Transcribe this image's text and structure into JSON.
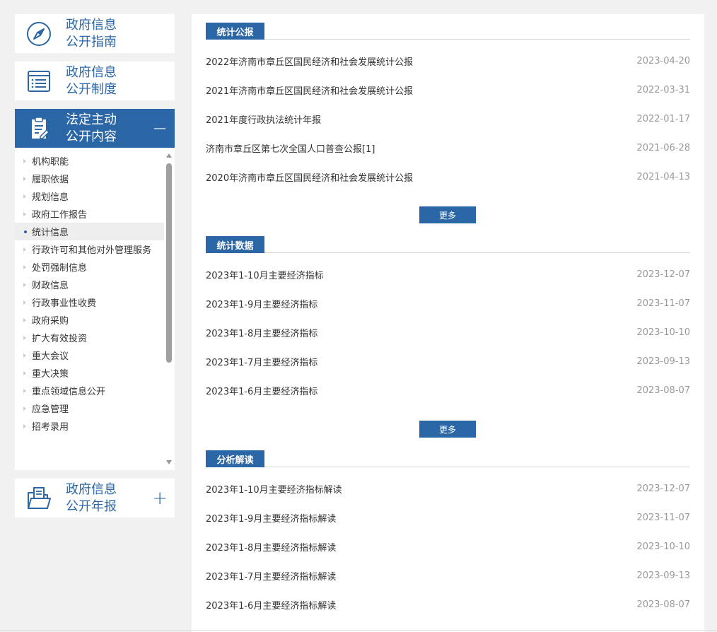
{
  "sidebar": {
    "guide": {
      "line1": "政府信息",
      "line2": "公开指南"
    },
    "system": {
      "line1": "政府信息",
      "line2": "公开制度"
    },
    "content": {
      "line1": "法定主动",
      "line2": "公开内容",
      "toggle": "−"
    },
    "annual": {
      "line1": "政府信息",
      "line2": "公开年报",
      "toggle": "+"
    },
    "items": [
      {
        "label": "机构职能"
      },
      {
        "label": "履职依据"
      },
      {
        "label": "规划信息"
      },
      {
        "label": "政府工作报告"
      },
      {
        "label": "统计信息"
      },
      {
        "label": "行政许可和其他对外管理服务"
      },
      {
        "label": "处罚强制信息"
      },
      {
        "label": "财政信息"
      },
      {
        "label": "行政事业性收费"
      },
      {
        "label": "政府采购"
      },
      {
        "label": "扩大有效投资"
      },
      {
        "label": "重大会议"
      },
      {
        "label": "重大决策"
      },
      {
        "label": "重点领域信息公开"
      },
      {
        "label": "应急管理"
      },
      {
        "label": "招考录用"
      }
    ],
    "selected_index": 4
  },
  "sections": [
    {
      "title": "统计公报",
      "more": "更多",
      "rows": [
        {
          "title": "2022年济南市章丘区国民经济和社会发展统计公报",
          "date": "2023-04-20"
        },
        {
          "title": "2021年济南市章丘区国民经济和社会发展统计公报",
          "date": "2022-03-31"
        },
        {
          "title": "2021年度行政执法统计年报",
          "date": "2022-01-17"
        },
        {
          "title": "济南市章丘区第七次全国人口普查公报[1]",
          "date": "2021-06-28"
        },
        {
          "title": "2020年济南市章丘区国民经济和社会发展统计公报",
          "date": "2021-04-13"
        }
      ]
    },
    {
      "title": "统计数据",
      "more": "更多",
      "rows": [
        {
          "title": "2023年1-10月主要经济指标",
          "date": "2023-12-07"
        },
        {
          "title": "2023年1-9月主要经济指标",
          "date": "2023-11-07"
        },
        {
          "title": "2023年1-8月主要经济指标",
          "date": "2023-10-10"
        },
        {
          "title": "2023年1-7月主要经济指标",
          "date": "2023-09-13"
        },
        {
          "title": "2023年1-6月主要经济指标",
          "date": "2023-08-07"
        }
      ]
    },
    {
      "title": "分析解读",
      "rows": [
        {
          "title": "2023年1-10月主要经济指标解读",
          "date": "2023-12-07"
        },
        {
          "title": "2023年1-9月主要经济指标解读",
          "date": "2023-11-07"
        },
        {
          "title": "2023年1-8月主要经济指标解读",
          "date": "2023-10-10"
        },
        {
          "title": "2023年1-7月主要经济指标解读",
          "date": "2023-09-13"
        },
        {
          "title": "2023年1-6月主要经济指标解读",
          "date": "2023-08-07"
        }
      ]
    }
  ],
  "colors": {
    "accent": "#2b66a6",
    "page_bg": "#f1f1f1",
    "date": "#999999"
  }
}
